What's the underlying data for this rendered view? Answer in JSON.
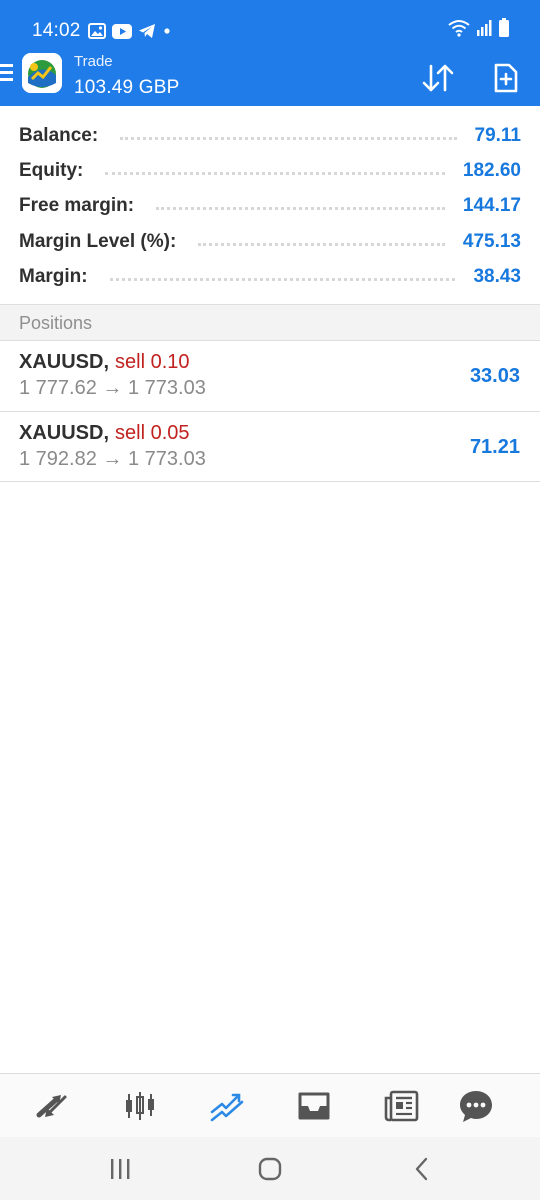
{
  "status_bar": {
    "time": "14:02",
    "notification_icons": [
      "gallery-icon",
      "youtube-icon",
      "telegram-icon",
      "dot-icon"
    ],
    "system_icons": [
      "wifi-icon",
      "signal-icon",
      "battery-icon"
    ]
  },
  "app_bar": {
    "title": "Trade",
    "account_value": "103.49 GBP",
    "actions": [
      "sort-icon",
      "new-order-icon"
    ]
  },
  "summary": {
    "rows": [
      {
        "label": "Balance:",
        "value": "79.11"
      },
      {
        "label": "Equity:",
        "value": "182.60"
      },
      {
        "label": "Free margin:",
        "value": "144.17"
      },
      {
        "label": "Margin Level (%):",
        "value": "475.13"
      },
      {
        "label": "Margin:",
        "value": "38.43"
      }
    ]
  },
  "positions": {
    "header": "Positions",
    "items": [
      {
        "symbol": "XAUUSD,",
        "side": "sell 0.10",
        "prices": "1 777.62 → 1 773.03",
        "profit": "33.03"
      },
      {
        "symbol": "XAUUSD,",
        "side": "sell 0.05",
        "prices": "1 792.82 → 1 773.03",
        "profit": "71.21"
      }
    ]
  },
  "bottom_nav": {
    "items": [
      "quotes-icon",
      "chart-icon",
      "trade-icon",
      "history-icon",
      "news-icon",
      "messages-icon"
    ],
    "active": "trade-icon"
  },
  "system_nav": [
    "recents-icon",
    "home-icon",
    "back-icon"
  ],
  "colors": {
    "brand_blue": "#1f7ce8",
    "value_blue": "#1778dd",
    "sell_red": "#c2221f",
    "muted_gray": "#8a8a8a"
  }
}
